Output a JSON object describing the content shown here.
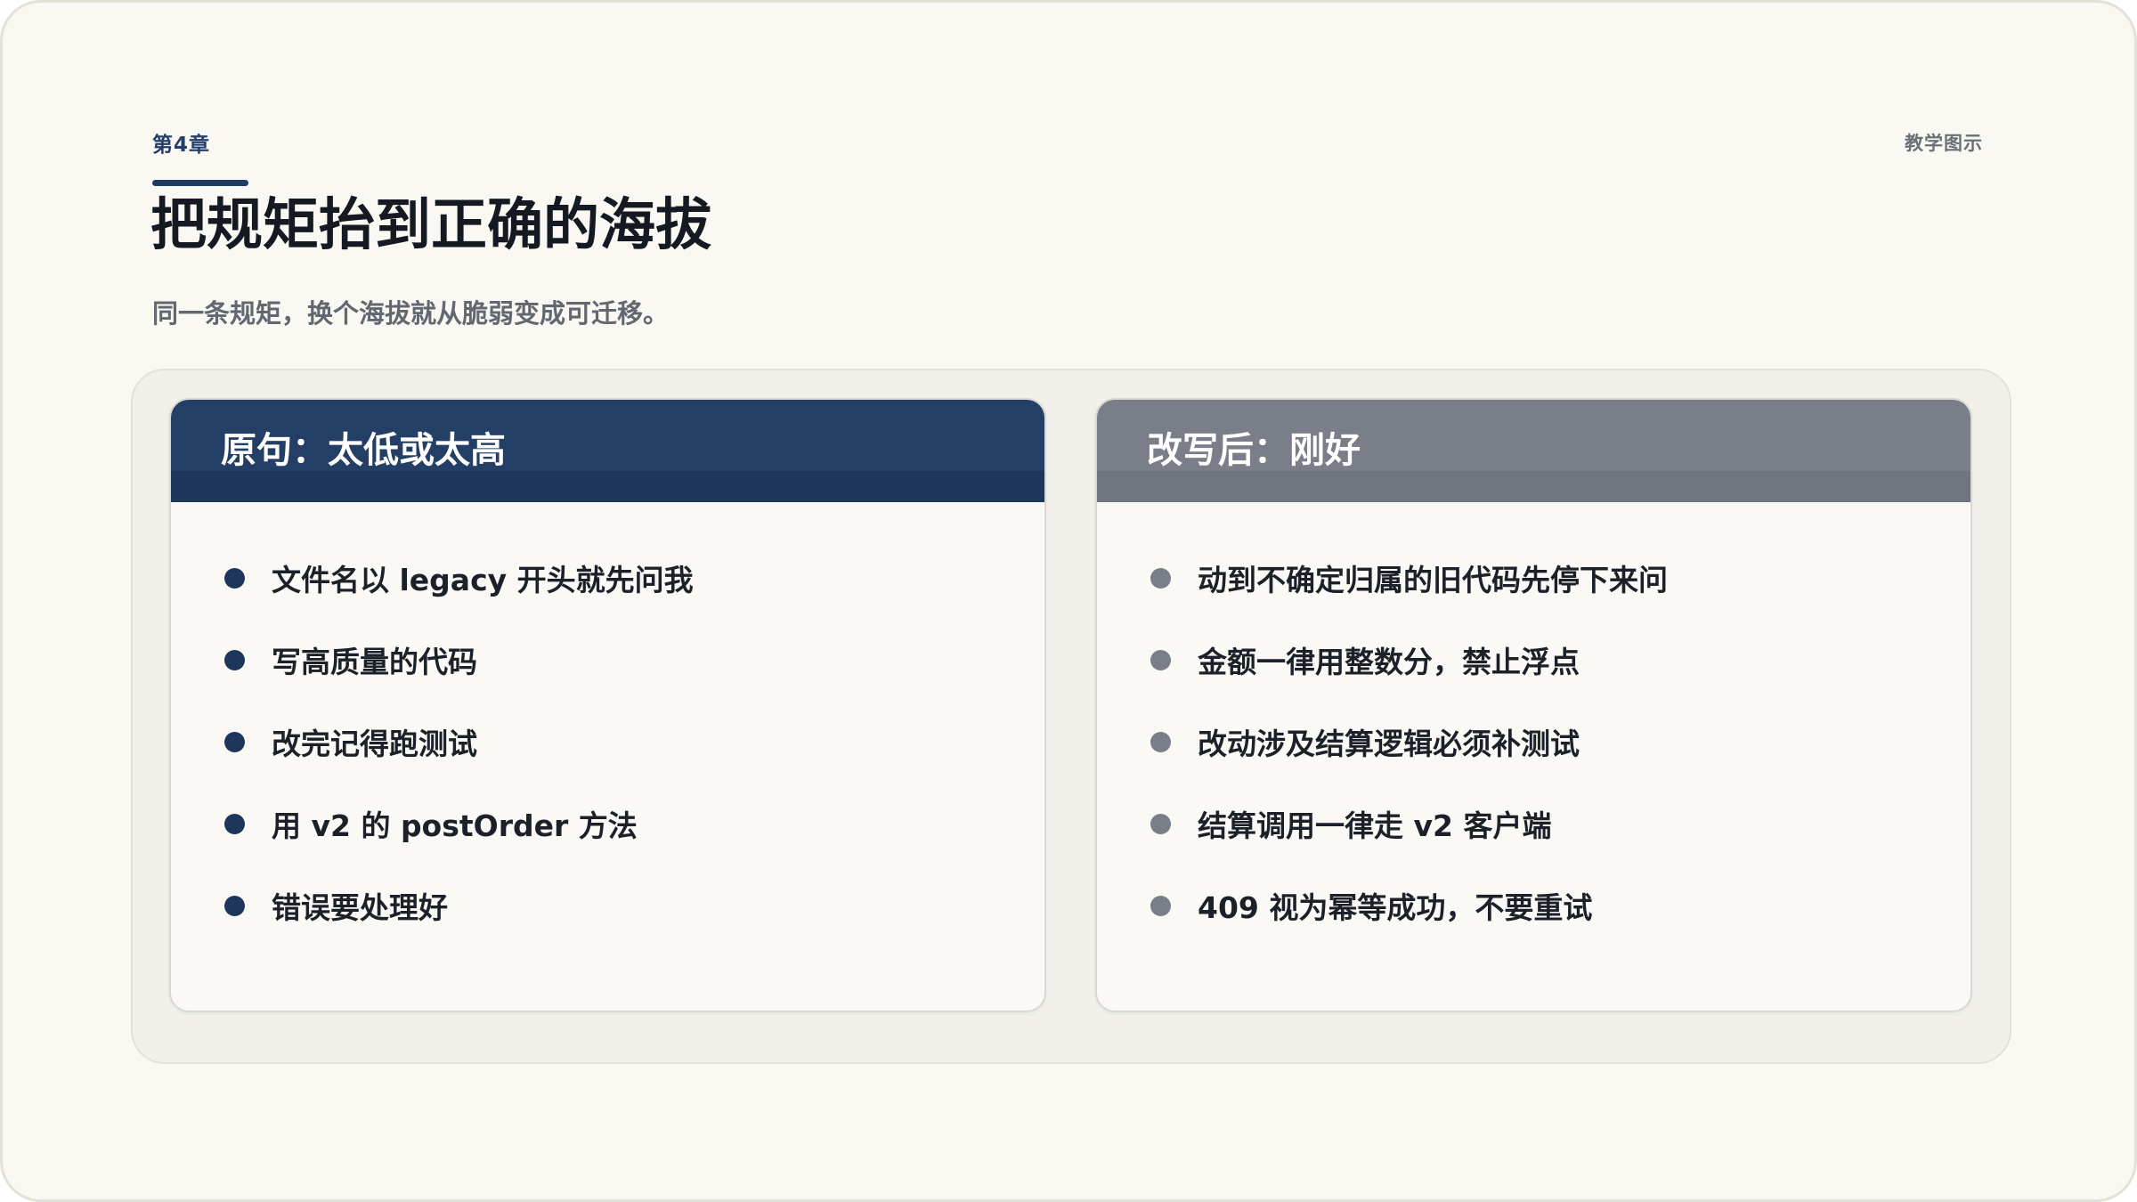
{
  "header": {
    "chapter": "第4章",
    "kicker": "教学图示",
    "title": "把规矩抬到正确的海拔",
    "subtitle": "同一条规矩，换个海拔就从脆弱变成可迁移。"
  },
  "cards": [
    {
      "title": "原句：太低或太高",
      "items": [
        "文件名以 legacy 开头就先问我",
        "写高质量的代码",
        "改完记得跑测试",
        "用 v2 的 postOrder 方法",
        "错误要处理好"
      ]
    },
    {
      "title": "改写后：刚好",
      "items": [
        "动到不确定归属的旧代码先停下来问",
        "金额一律用整数分，禁止浮点",
        "改动涉及结算逻辑必须补测试",
        "结算调用一律走 v2 客户端",
        "409 视为幂等成功，不要重试"
      ]
    }
  ],
  "colors": {
    "navy": "#243f66",
    "slate": "#7a7e88",
    "background": "#f9f8f3"
  }
}
